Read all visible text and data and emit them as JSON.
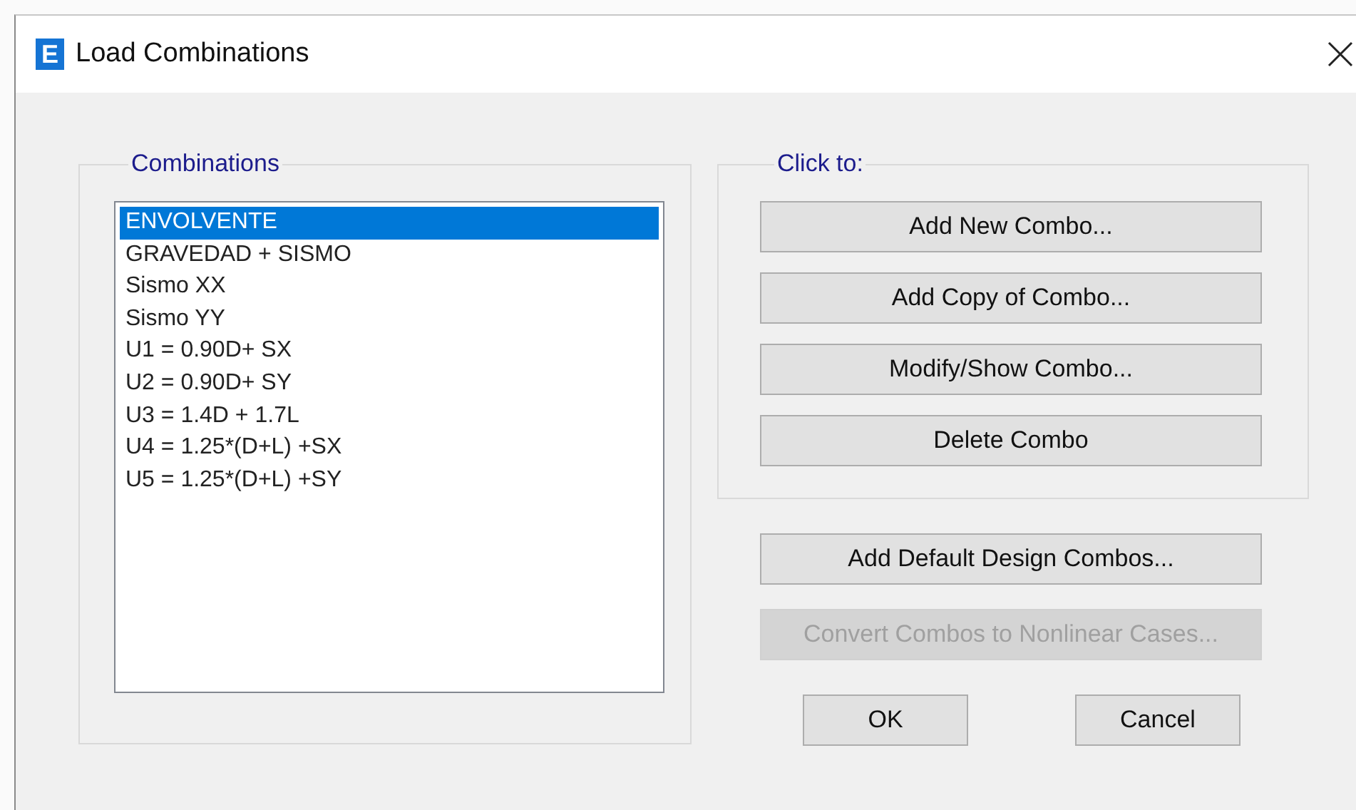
{
  "window": {
    "icon_text": "E",
    "title": "Load Combinations"
  },
  "combinations": {
    "label": "Combinations",
    "items": [
      {
        "name": "ENVOLVENTE",
        "selected": true
      },
      {
        "name": "GRAVEDAD + SISMO",
        "selected": false
      },
      {
        "name": "Sismo XX",
        "selected": false
      },
      {
        "name": "Sismo YY",
        "selected": false
      },
      {
        "name": "U1 = 0.90D+ SX",
        "selected": false
      },
      {
        "name": "U2 = 0.90D+ SY",
        "selected": false
      },
      {
        "name": "U3 = 1.4D + 1.7L",
        "selected": false
      },
      {
        "name": "U4 = 1.25*(D+L) +SX",
        "selected": false
      },
      {
        "name": "U5 = 1.25*(D+L) +SY",
        "selected": false
      }
    ]
  },
  "actions": {
    "label": "Click to:",
    "buttons": [
      {
        "label": "Add New Combo...",
        "disabled": false
      },
      {
        "label": "Add Copy of Combo...",
        "disabled": false
      },
      {
        "label": "Modify/Show Combo...",
        "disabled": false
      },
      {
        "label": "Delete Combo",
        "disabled": false
      }
    ]
  },
  "extra_buttons": [
    {
      "label": "Add Default Design Combos...",
      "disabled": false
    },
    {
      "label": "Convert Combos to Nonlinear Cases...",
      "disabled": true
    }
  ],
  "dialog_buttons": [
    {
      "label": "OK"
    },
    {
      "label": "Cancel"
    }
  ]
}
